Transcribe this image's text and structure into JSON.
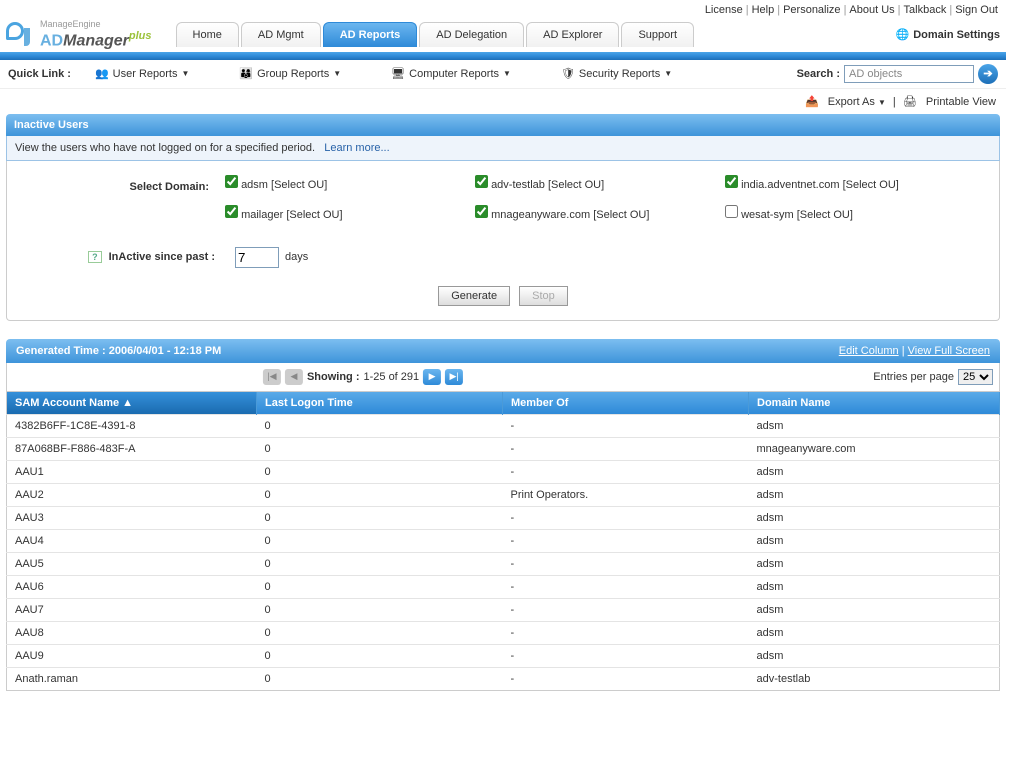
{
  "topLinks": [
    "License",
    "Help",
    "Personalize",
    "About Us",
    "Talkback",
    "Sign Out"
  ],
  "logo": {
    "manage": "ManageEngine",
    "ad": "AD",
    "manager": "Manager",
    "plus": "plus"
  },
  "tabs": [
    "Home",
    "AD Mgmt",
    "AD Reports",
    "AD Delegation",
    "AD Explorer",
    "Support"
  ],
  "activeTab": 2,
  "domainSettings": "Domain Settings",
  "quickLink": {
    "label": "Quick Link :",
    "items": [
      "User Reports",
      "Group Reports",
      "Computer Reports",
      "Security Reports"
    ],
    "searchLabel": "Search :",
    "searchPlaceholder": "AD objects"
  },
  "toolbar": {
    "exportAs": "Export As",
    "sep": "|",
    "printable": "Printable View"
  },
  "panel": {
    "title": "Inactive Users",
    "sub": "View the users who have not logged on for a specified period.",
    "learn": "Learn more...",
    "selectDomain": "Select Domain:",
    "domains": [
      {
        "name": "adsm",
        "checked": true
      },
      {
        "name": "adv-testlab",
        "checked": true
      },
      {
        "name": "india.adventnet.com",
        "checked": true
      },
      {
        "name": "mailager",
        "checked": true
      },
      {
        "name": "mnageanyware.com",
        "checked": true
      },
      {
        "name": "wesat-sym",
        "checked": false
      }
    ],
    "ou": "[Select OU]",
    "inactiveLabel": "InActive since past :",
    "days": "7",
    "daysUnit": "days",
    "generate": "Generate",
    "stop": "Stop"
  },
  "result": {
    "genTimePrefix": "Generated Time : ",
    "genTime": "2006/04/01 - 12:18 PM",
    "editCol": "Edit Column",
    "sep": "|",
    "viewFull": "View Full Screen",
    "showingPrefix": "Showing : ",
    "showing": "1-25 of 291",
    "eppLabel": "Entries per page",
    "epp": "25",
    "cols": [
      "SAM Account Name",
      "Last Logon Time",
      "Member Of",
      "Domain Name"
    ],
    "sortCol": 0,
    "rows": [
      {
        "sam": "4382B6FF-1C8E-4391-8",
        "last": "0",
        "member": "-",
        "dom": "adsm"
      },
      {
        "sam": "87A068BF-F886-483F-A",
        "last": "0",
        "member": "-",
        "dom": "mnageanyware.com"
      },
      {
        "sam": "AAU1",
        "last": "0",
        "member": "-",
        "dom": "adsm"
      },
      {
        "sam": "AAU2",
        "last": "0",
        "member": "Print Operators.",
        "dom": "adsm"
      },
      {
        "sam": "AAU3",
        "last": "0",
        "member": "-",
        "dom": "adsm"
      },
      {
        "sam": "AAU4",
        "last": "0",
        "member": "-",
        "dom": "adsm"
      },
      {
        "sam": "AAU5",
        "last": "0",
        "member": "-",
        "dom": "adsm"
      },
      {
        "sam": "AAU6",
        "last": "0",
        "member": "-",
        "dom": "adsm"
      },
      {
        "sam": "AAU7",
        "last": "0",
        "member": "-",
        "dom": "adsm"
      },
      {
        "sam": "AAU8",
        "last": "0",
        "member": "-",
        "dom": "adsm"
      },
      {
        "sam": "AAU9",
        "last": "0",
        "member": "-",
        "dom": "adsm"
      },
      {
        "sam": "Anath.raman",
        "last": "0",
        "member": "-",
        "dom": "adv-testlab"
      }
    ]
  }
}
